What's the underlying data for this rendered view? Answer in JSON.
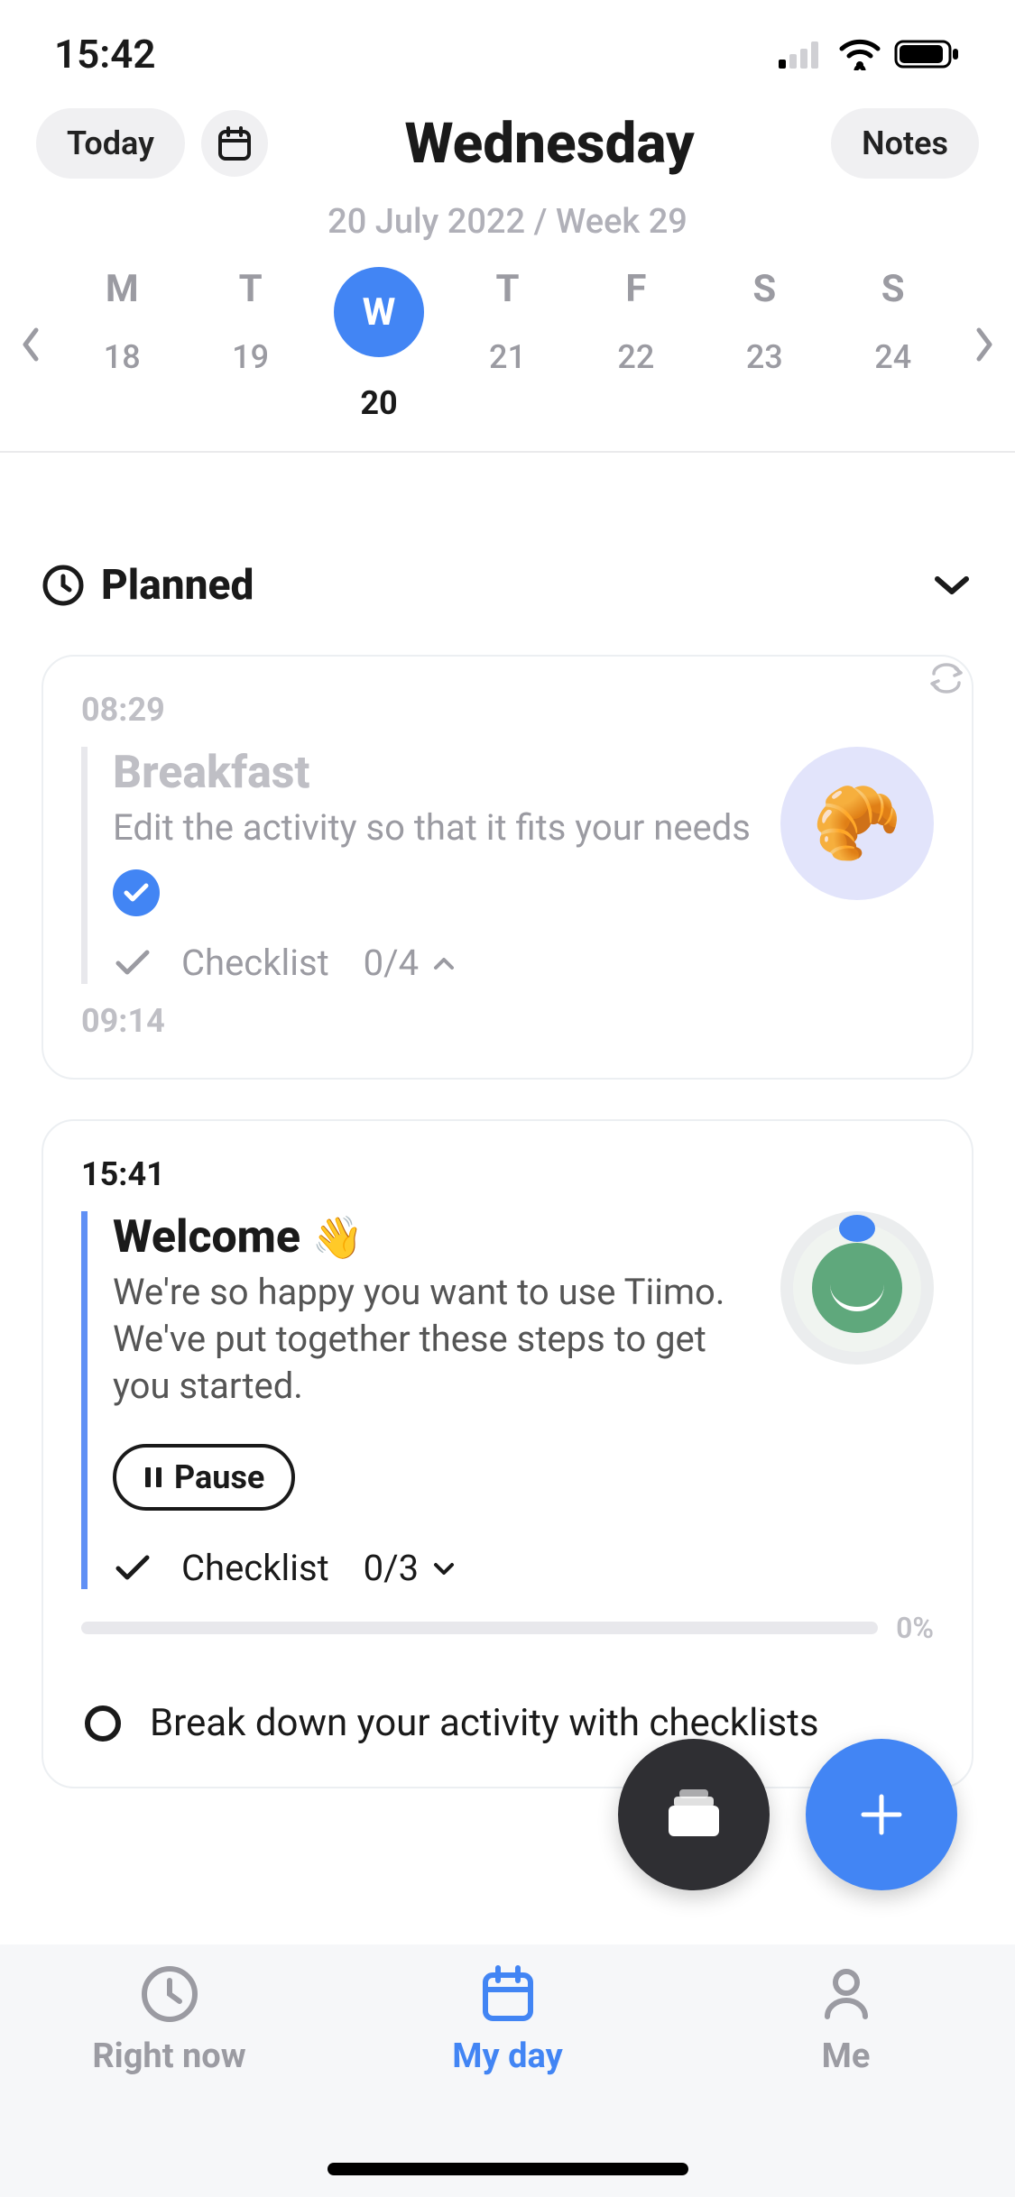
{
  "status": {
    "time": "15:42"
  },
  "header": {
    "today_label": "Today",
    "title": "Wednesday",
    "subtitle": "20 July 2022 / Week 29",
    "notes_label": "Notes"
  },
  "week": {
    "days": [
      {
        "letter": "M",
        "num": "18",
        "selected": false
      },
      {
        "letter": "T",
        "num": "19",
        "selected": false
      },
      {
        "letter": "W",
        "num": "20",
        "selected": true
      },
      {
        "letter": "T",
        "num": "21",
        "selected": false
      },
      {
        "letter": "F",
        "num": "22",
        "selected": false
      },
      {
        "letter": "S",
        "num": "23",
        "selected": false
      },
      {
        "letter": "S",
        "num": "24",
        "selected": false
      }
    ]
  },
  "section": {
    "planned_label": "Planned"
  },
  "cards": {
    "breakfast": {
      "start": "08:29",
      "end": "09:14",
      "title": "Breakfast",
      "desc": "Edit the activity so that it fits your needs",
      "checklist_label": "Checklist",
      "checklist_count": "0/4",
      "icon_emoji": "🥐"
    },
    "welcome": {
      "start": "15:41",
      "title": "Welcome",
      "title_emoji": "👋",
      "desc": "We're so happy you want to use Tiimo. We've put together these steps to get you started.",
      "pause_label": "Pause",
      "checklist_label": "Checklist",
      "checklist_count": "0/3",
      "progress_pct": "0%",
      "subtask1": "Break down your activity with checklists"
    }
  },
  "nav": {
    "right_now": "Right now",
    "my_day": "My day",
    "me": "Me"
  }
}
